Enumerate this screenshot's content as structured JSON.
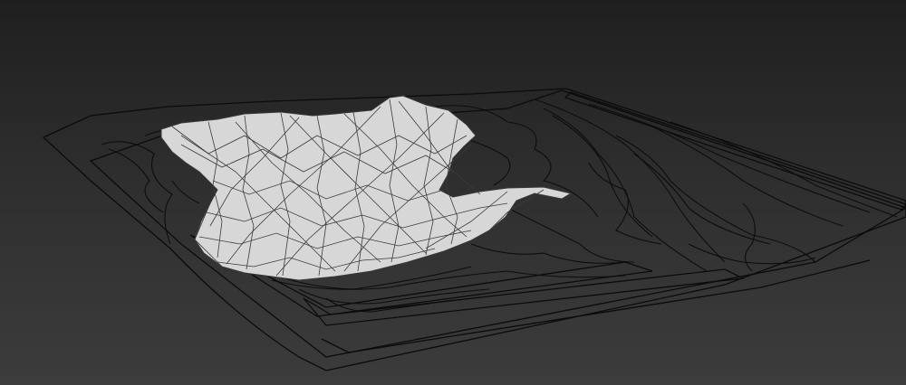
{
  "viewport": {
    "view_mode": "perspective",
    "shading": "wireframe-over-shaded",
    "background_top": "#1f1f1f",
    "background_bottom": "#3c3c3c"
  },
  "scene": {
    "terrain_mesh": {
      "face_color": "#d7d7d7",
      "wire_color": "#3a3a3a"
    },
    "contour_lines": {
      "color": "#0d0d0d"
    }
  }
}
